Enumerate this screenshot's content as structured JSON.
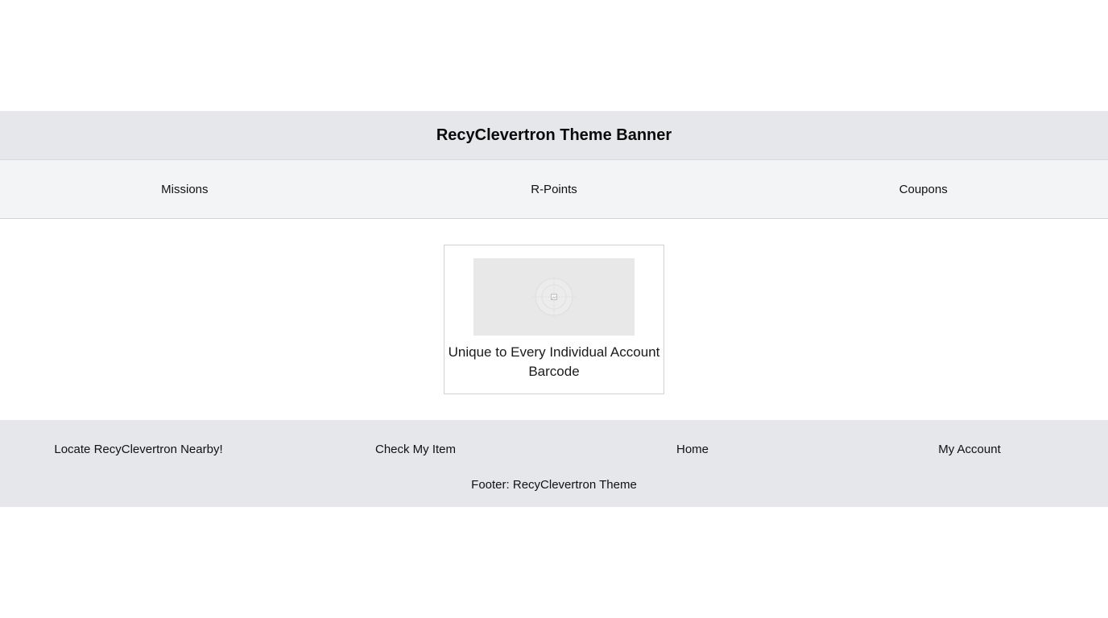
{
  "banner": {
    "title": "RecyClevertron Theme Banner"
  },
  "nav": {
    "tabs": [
      {
        "label": "Missions"
      },
      {
        "label": "R-Points"
      },
      {
        "label": "Coupons"
      }
    ]
  },
  "card": {
    "image_icon": "broken-image-icon",
    "caption": "Unique to Every Individual Account Barcode"
  },
  "footer": {
    "links": [
      {
        "label": "Locate RecyClevertron Nearby!"
      },
      {
        "label": "Check My Item"
      },
      {
        "label": "Home"
      },
      {
        "label": "My Account"
      }
    ],
    "note": "Footer: RecyClevertron Theme"
  },
  "colors": {
    "banner_bg": "#e5e7eb",
    "nav_bg": "#f3f4f6",
    "footer_bg": "#e5e7eb",
    "image_placeholder_bg": "#e8e8e8"
  }
}
